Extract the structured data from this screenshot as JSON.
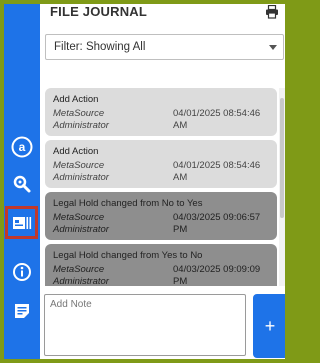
{
  "panel": {
    "title": "FILE JOURNAL"
  },
  "filter": {
    "value": "Filter: Showing All"
  },
  "entries": [
    {
      "action": "Add Action",
      "source": "MetaSource",
      "user": "Administrator",
      "datetime": "04/01/2025 08:54:46 AM",
      "style": "light"
    },
    {
      "action": "Add Action",
      "source": "MetaSource",
      "user": "Administrator",
      "datetime": "04/01/2025 08:54:46 AM",
      "style": "light"
    },
    {
      "action": "Legal Hold changed from No to Yes",
      "source": "MetaSource",
      "user": "Administrator",
      "datetime": "04/03/2025 09:06:57 PM",
      "style": "dark"
    },
    {
      "action": "Legal Hold changed from Yes to No",
      "source": "MetaSource",
      "user": "Administrator",
      "datetime": "04/03/2025 09:09:09 PM",
      "style": "dark"
    }
  ],
  "note": {
    "placeholder": "Add Note"
  },
  "add_button": {
    "label": "+"
  },
  "rail": {
    "items": [
      {
        "name": "metasource-logo-icon"
      },
      {
        "name": "search-icon"
      },
      {
        "name": "file-journal-icon",
        "active": true
      },
      {
        "name": "info-icon"
      },
      {
        "name": "notes-icon"
      }
    ]
  },
  "colors": {
    "accent": "#1e73e8",
    "active_outline": "#c0392b",
    "frame": "#7f9a17"
  }
}
